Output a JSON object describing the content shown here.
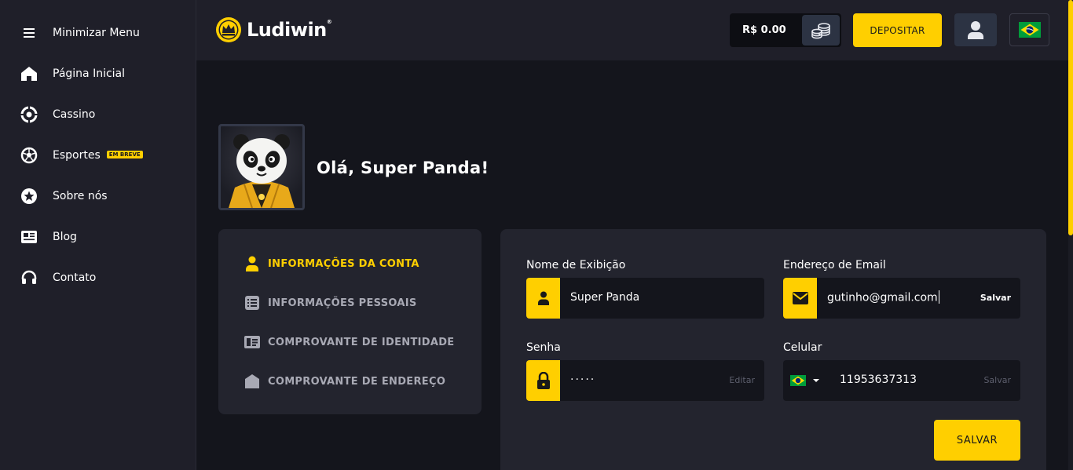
{
  "sidebar": {
    "items": [
      {
        "label": "Minimizar Menu",
        "icon": "menu-icon"
      },
      {
        "label": "Página Inicial",
        "icon": "home-icon"
      },
      {
        "label": "Cassino",
        "icon": "casino-chip-icon"
      },
      {
        "label": "Esportes",
        "icon": "soccer-ball-icon",
        "badge": "EM BREVE"
      },
      {
        "label": "Sobre nós",
        "icon": "star-icon"
      },
      {
        "label": "Blog",
        "icon": "newspaper-icon"
      },
      {
        "label": "Contato",
        "icon": "headset-icon"
      }
    ]
  },
  "header": {
    "logo_text": "Ludiwin",
    "logo_reg": "®",
    "balance": "R$ 0.00",
    "deposit_label": "DEPOSITAR",
    "accent": "#ffcf00"
  },
  "profile": {
    "greeting": "Olá, Super Panda!"
  },
  "account_menu": {
    "items": [
      {
        "label": "INFORMAÇÕES DA CONTA",
        "icon": "user-icon",
        "active": true
      },
      {
        "label": "INFORMAÇÕES PESSOAIS",
        "icon": "list-icon",
        "active": false
      },
      {
        "label": "COMPROVANTE DE IDENTIDADE",
        "icon": "id-card-icon",
        "active": false
      },
      {
        "label": "COMPROVANTE DE ENDEREÇO",
        "icon": "house-icon",
        "active": false
      }
    ]
  },
  "form": {
    "display_name": {
      "label": "Nome de Exibição",
      "value": "Super Panda"
    },
    "email": {
      "label": "Endereço de Email",
      "value": "gutinho@gmail.com",
      "action": "Salvar"
    },
    "password": {
      "label": "Senha",
      "value": "·····",
      "action": "Editar"
    },
    "phone": {
      "label": "Celular",
      "value": "11953637313",
      "action": "Salvar"
    },
    "save_label": "SALVAR"
  }
}
